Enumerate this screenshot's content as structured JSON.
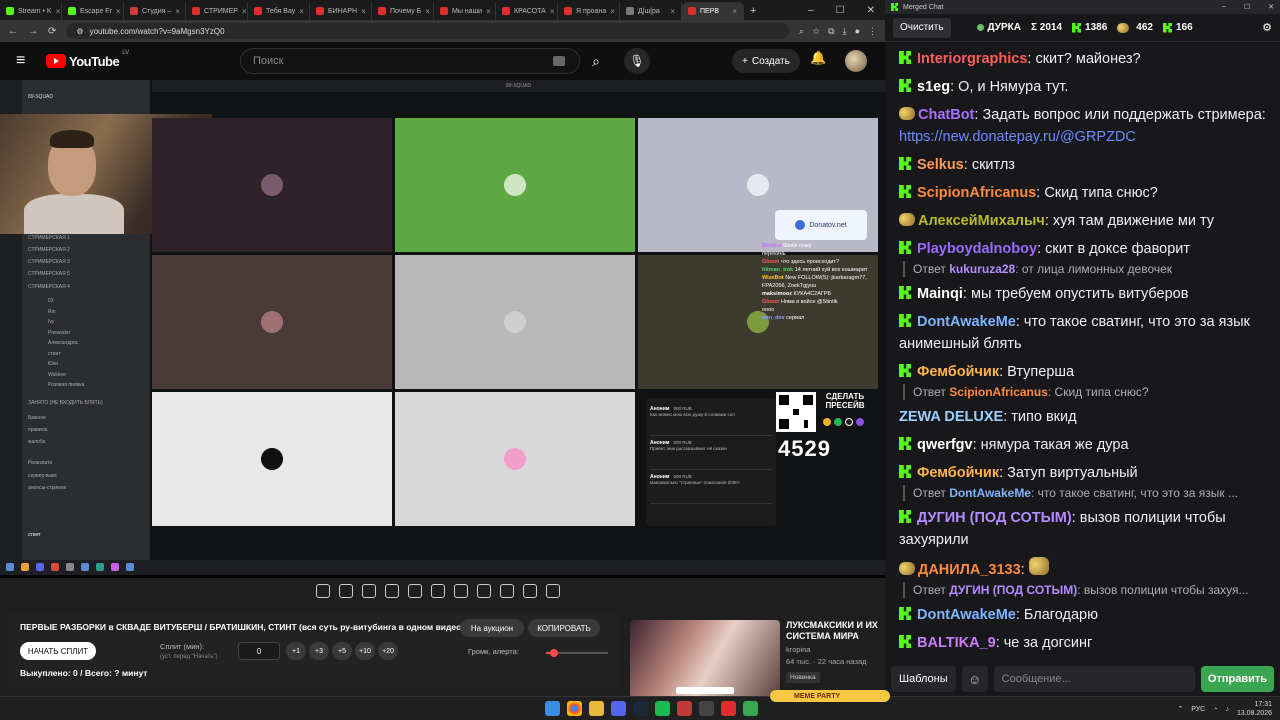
{
  "browser": {
    "tabs": [
      "Stream • K",
      "Escape Fr",
      "Студия –",
      "СТРИМЕР",
      "Тебя Вау",
      "БИНАРН",
      "Почему Б",
      "Мы наши",
      "КРАСОТА",
      "Я проана",
      "Д|ш|ра",
      "ПЕРВ"
    ],
    "url": "youtube.com/watch?v=9aMgsn3YzQ0"
  },
  "youtube": {
    "logo": "YouTube",
    "region": "LV",
    "search_placeholder": "Поиск",
    "create_label": "Создать"
  },
  "discord": {
    "server": "89-SQUAD",
    "channels": [
      "СТРИМЕРСКАЯ 1",
      "СТРИМЕРСКАЯ 2",
      "СТРИМЕРСКАЯ 3",
      "СТРИМЕРСКАЯ 5",
      "СТРИМЕРСКАЯ 4",
      "ЗАНЯТО (НЕ ВХОДИТЬ БЛЯТЬ)",
      "Важное",
      "правила",
      "жалоба",
      "Релизпати",
      "сервер-вывс",
      "анонсы-стримов"
    ],
    "users": [
      "03",
      "Rin",
      "Ivy",
      "Pnewsder",
      "Александрис",
      "стинт",
      "Юки",
      "Wakkee",
      "Розовая пиявка"
    ],
    "self": "стинт"
  },
  "overlay": {
    "donatov": "Donatov.net",
    "chat": [
      {
        "n": "Bertina",
        "t": "Stintik пожу"
      },
      {
        "n": "",
        "t": "перекинь"
      },
      {
        "n": "Gloom",
        "t": "что здесь происходит?"
      },
      {
        "n": "hitman_trak",
        "t": "14 летний хуй все кошмарит"
      },
      {
        "n": "WizeBot",
        "t": "New FOLLOW(S): jbarbaragm77, FPA2056, ZoekTgjyuu"
      },
      {
        "n": "maksimooz",
        "t": "КУКА4С2АГРБ"
      },
      {
        "n": "Gloom",
        "t": "Няма в войсе @Stintik"
      },
      {
        "n": "",
        "t": "оооо"
      },
      {
        "n": "pon_dev",
        "t": "сериал"
      }
    ],
    "cta": "СДЕЛАТЬ ПРЕСЕЙВ",
    "counter": "4529",
    "donations": [
      {
        "name": "Аноним",
        "amount": "500 RUB",
        "text": "Как можно мою всю душу й словами сол"
      },
      {
        "name": "Аноним",
        "amount": "500 RUB",
        "text": "Привет, мне рассказывают её сказки"
      },
      {
        "name": "Аноним",
        "amount": "500 RUB",
        "text": "максимально \"странные\" пожелания 2000+"
      }
    ]
  },
  "panel": {
    "title": "ПЕРВЫЕ РАЗБОРКИ в СКВАДЕ ВИТУБЕРШ / БРАТИШКИН, СТИНТ (вся суть ру-витубинга в одном видео)",
    "auction": "На аукцион",
    "copy": "КОПИРОВАТЬ",
    "start_split": "НАЧАТЬ СПЛИТ",
    "split_label": "Сплит (мин):",
    "split_hint": "(уст. перед \"Начать\")",
    "split_value": "0",
    "increments": [
      "+1",
      "+3",
      "+5",
      "+10",
      "+20"
    ],
    "volume_label": "Громк. алерта:",
    "volume_level": 0.13,
    "status": "Выкуплено: 0 / Всего: ? минут"
  },
  "recommendation": {
    "title": "ЛУКСМАКСИКИ И ИХ СИСТЕМА МИРА",
    "channel": "kropina",
    "views": "64 тыс.",
    "age": "22 часа назад",
    "badge": "Новинка"
  },
  "chat": {
    "window_title": "Merged Chat",
    "clear": "Очистить",
    "channel": "ДУРКА",
    "total": "Σ 2014",
    "kick_count": "1386",
    "yt_count": "462",
    "tw_count": "166",
    "messages": [
      {
        "user": "Interiorgraphics",
        "color": "#ff5c5c",
        "text": "скит? майонез?",
        "src": "kick"
      },
      {
        "user": "s1eg",
        "color": "#ffffff",
        "text": "О, и Нямура тут.",
        "src": "kick"
      },
      {
        "user": "ChatBot",
        "color": "#a970ff",
        "text": "Задать вопрос или поддержать стримера: ",
        "link": "https://new.donatepay.ru/@GRPZDC",
        "src": "emo"
      },
      {
        "user": "Selkus",
        "color": "#ff9a5c",
        "text": "скитлз",
        "src": "kick"
      },
      {
        "user": "ScipionAfricanus",
        "color": "#ff8a3c",
        "text": "Скид типа снюс?",
        "src": "kick"
      },
      {
        "user": "АлексейМихалыч",
        "color": "#b9b92f",
        "text": "хуя там движение ми ту",
        "src": "emo"
      },
      {
        "user": "Playboydalnoboy",
        "color": "#9b6bff",
        "text": "скит в доксе фаворит",
        "src": "kick",
        "reply": {
          "user": "kukuruza28",
          "text": "от лица лимонных девочек"
        }
      },
      {
        "user": "Mainqi",
        "color": "#ffffff",
        "text": "мы требуем опустить витуберов",
        "src": "kick"
      },
      {
        "user": "DontAwakeMe",
        "color": "#7fb5ff",
        "text": "что такое сватинг, что это за язык анимешный блять",
        "src": "kick"
      },
      {
        "user": "Фембойчик",
        "color": "#ffb347",
        "text": "Втуперша",
        "src": "kick",
        "reply": {
          "user": "ScipionAfricanus",
          "text": "Скид типа снюс?"
        }
      },
      {
        "user": "ZEWA DELUXE",
        "color": "#9ad0ff",
        "text": "типо вкид",
        "src": "none"
      },
      {
        "user": "qwerfgv",
        "color": "#ffffff",
        "text": "нямура такая же дура",
        "src": "kick"
      },
      {
        "user": "Фембойчик",
        "color": "#ffb347",
        "text": "Затуп виртуальный",
        "src": "kick",
        "reply": {
          "user": "DontAwakeMe",
          "text": "что такое сватинг, что это за язык ..."
        }
      },
      {
        "user": "ДУГИН (ПОД СОТЫМ)",
        "color": "#b48cff",
        "text": "вызов полиции чтобы захуярили",
        "src": "kick"
      },
      {
        "user": "ДАНИЛА_3133",
        "color": "#ff8a3c",
        "text": "",
        "src": "emo",
        "reply": {
          "user": "ДУГИН (ПОД СОТЫМ)",
          "text": "вызов полиции чтобы захуя..."
        }
      },
      {
        "user": "DontAwakeMe",
        "color": "#7fb5ff",
        "text": "Благодарю",
        "src": "kick"
      },
      {
        "user": "BALTIKA_9",
        "color": "#c77dff",
        "text": "че за догсинг",
        "src": "kick"
      }
    ],
    "templates": "Шаблоны",
    "placeholder": "Сообщение...",
    "send": "Отправить"
  },
  "taskbar": {
    "lang": "РУС",
    "time": "17:31",
    "date": "13.08.2026",
    "meme": "MEME PARTY"
  }
}
